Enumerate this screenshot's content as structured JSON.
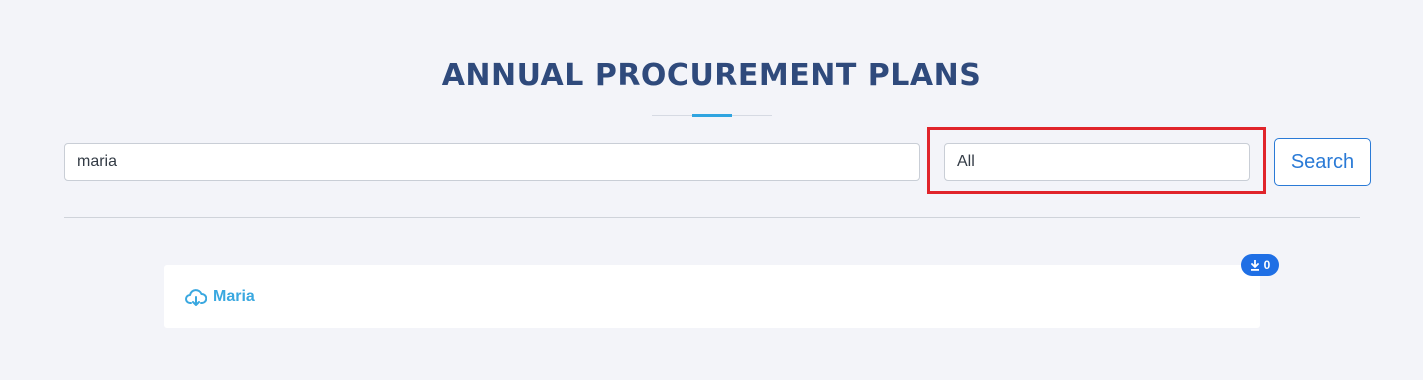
{
  "header": {
    "title": "ANNUAL PROCUREMENT PLANS"
  },
  "search": {
    "query": "maria",
    "category": "All",
    "button_label": "Search"
  },
  "results": [
    {
      "name": "Maria",
      "download_count": "0",
      "icon": "cloud-download-icon"
    }
  ],
  "colors": {
    "title": "#2f4a7c",
    "accent": "#2fa4e0",
    "primary": "#2a7ad6",
    "highlight": "#e0242b",
    "badge": "#1f6fe5",
    "link": "#3aa8e0"
  }
}
